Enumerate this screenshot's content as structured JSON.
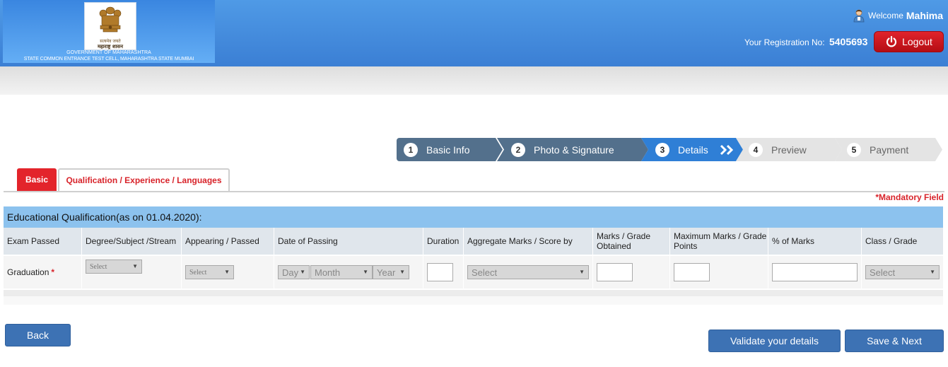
{
  "header": {
    "emblem_motto": "सत्यमेव जयते",
    "emblem_script": "महाराष्ट्र शासन",
    "org_line1": "GOVERNMENT OF MAHARASHTRA",
    "org_line2": "STATE COMMON ENTRANCE TEST CELL, MAHARASHTRA STATE MUMBAI",
    "welcome_label": "Welcome",
    "user_name": "Mahima",
    "reg_label": "Your Registration No:",
    "reg_no": "5405693",
    "logout_label": "Logout"
  },
  "steps": [
    {
      "num": "1",
      "label": "Basic Info",
      "state": "done"
    },
    {
      "num": "2",
      "label": "Photo & Signature",
      "state": "done"
    },
    {
      "num": "3",
      "label": "Details",
      "state": "active"
    },
    {
      "num": "4",
      "label": "Preview",
      "state": "pending"
    },
    {
      "num": "5",
      "label": "Payment",
      "state": "pending"
    }
  ],
  "tabs": {
    "basic": "Basic",
    "qualification": "Qualification / Experience / Languages"
  },
  "mandatory_note": "*Mandatory Field",
  "section_title": "Educational Qualification(as on 01.04.2020):",
  "table": {
    "headers": [
      "Exam Passed",
      "Degree/Subject /Stream",
      "Appearing / Passed",
      "Date of Passing",
      "Duration",
      "Aggregate Marks / Score by",
      "Marks / Grade Obtained",
      "Maximum Marks / Grade Points",
      "% of Marks",
      "Class / Grade"
    ],
    "row": {
      "exam": "Graduation",
      "required_mark": "*",
      "degree_select": "Select",
      "appearing_select": "Select",
      "day_select": "Day",
      "month_select": "Month",
      "year_select": "Year",
      "aggregate_select": "Select",
      "class_select": "Select"
    }
  },
  "buttons": {
    "back": "Back",
    "validate": "Validate your details",
    "save_next": "Save & Next"
  },
  "colors": {
    "header_blue": "#3b7fd4",
    "step_done": "#53708c",
    "step_active": "#2f7fd6",
    "step_pending": "#e4e4e4",
    "accent_red": "#e3242b",
    "section_blue": "#8cc2ee",
    "button_blue": "#3d72b4"
  }
}
